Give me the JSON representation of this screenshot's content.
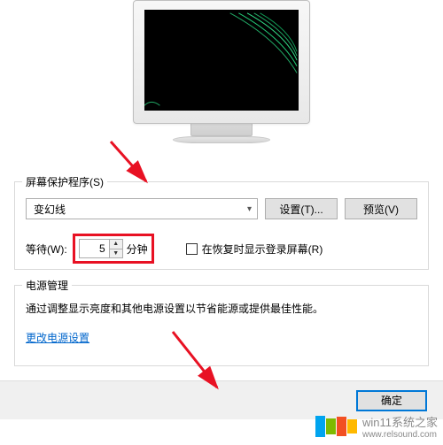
{
  "screensaver": {
    "group_label": "屏幕保护程序(S)",
    "selected": "变幻线",
    "settings_btn": "设置(T)...",
    "preview_btn": "预览(V)",
    "wait_label": "等待(W):",
    "wait_value": "5",
    "wait_unit": "分钟",
    "resume_checkbox_label": "在恢复时显示登录屏幕(R)"
  },
  "power": {
    "group_label": "电源管理",
    "description": "通过调整显示亮度和其他电源设置以节省能源或提供最佳性能。",
    "link": "更改电源设置"
  },
  "buttons": {
    "ok": "确定"
  },
  "watermark": {
    "text": "win11系统之家",
    "url": "www.relsound.com"
  }
}
